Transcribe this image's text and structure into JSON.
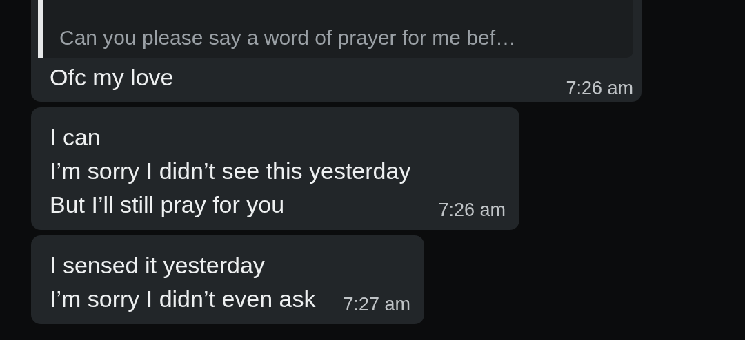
{
  "messages": [
    {
      "quote": "Can you please say a word of prayer for me bef…",
      "text": "Ofc my love",
      "time": "7:26 am"
    },
    {
      "text": "I can\nI’m sorry I didn’t see this yesterday\nBut I’ll still pray for you",
      "time": "7:26 am"
    },
    {
      "text": "I sensed it yesterday\nI’m sorry I didn’t even ask",
      "time": "7:27 am"
    }
  ]
}
